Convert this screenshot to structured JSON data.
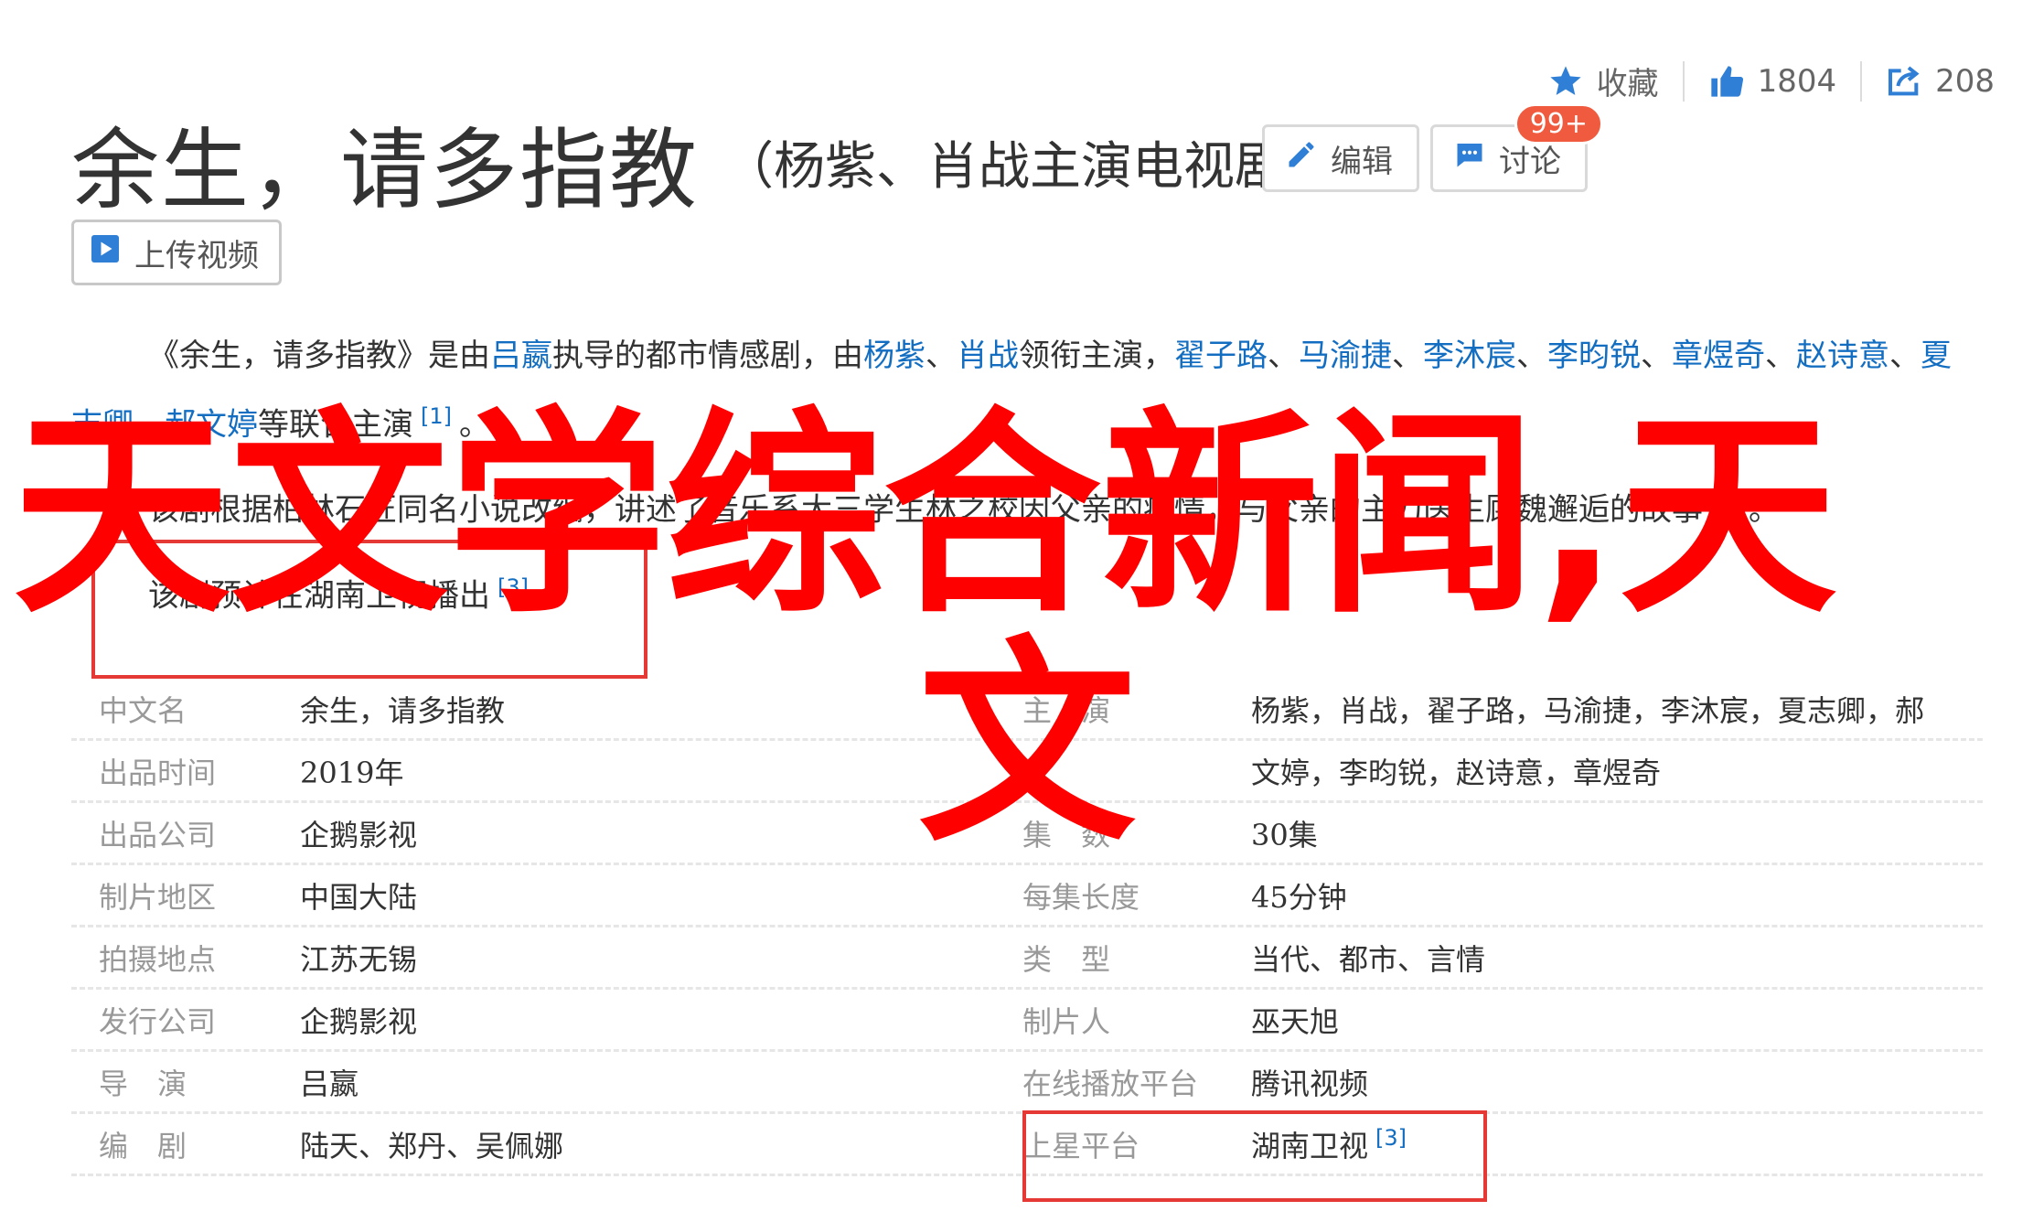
{
  "header": {
    "actions": [
      {
        "icon": "star-icon",
        "label": "收藏"
      },
      {
        "icon": "thumbs-up-icon",
        "label": "1804"
      },
      {
        "icon": "share-icon",
        "label": "208"
      }
    ],
    "title": "余生，请多指教",
    "subtitle": "（杨紫、肖战主演电视剧）",
    "edit_label": "编辑",
    "discuss_label": "讨论",
    "discuss_badge": "99+",
    "upload_label": "上传视频"
  },
  "summary": {
    "p1": {
      "t1": "《余生，请多指教》是由",
      "director": "吕嬴",
      "t2": "执导的都市情感剧，由",
      "lead1": "杨紫",
      "sep1": "、",
      "lead2": "肖战",
      "t3": "领衔主演，",
      "cast": [
        "翟子路",
        "马渝捷",
        "李沐宸",
        "李昀锐",
        "章煜奇",
        "赵诗意",
        "夏志卿",
        "郝文婷"
      ],
      "t4": "等联合主演",
      "ref": "[1]",
      "end": "。"
    },
    "p2": {
      "text": "该剧根据柏林石匠同名小说改编，讲述了音乐系大三学生林之校因父亲的病情，与父亲的主刀医生顾魏邂逅的故事",
      "ref": "[2]",
      "end": "。"
    },
    "p3": {
      "text": "该剧预计在湖南卫视播出",
      "ref": "[3]"
    }
  },
  "info": {
    "left": [
      {
        "k": "中文名",
        "v": "余生，请多指教"
      },
      {
        "k": "出品时间",
        "v": "2019年"
      },
      {
        "k": "出品公司",
        "v": "企鹅影视"
      },
      {
        "k": "制片地区",
        "v": "中国大陆"
      },
      {
        "k": "拍摄地点",
        "v": "江苏无锡"
      },
      {
        "k": "发行公司",
        "v": "企鹅影视"
      },
      {
        "k": "导　演",
        "v": "吕嬴"
      },
      {
        "k": "编　剧",
        "v": "陆天、郑丹、吴佩娜"
      }
    ],
    "right": [
      {
        "k": "主　演",
        "v": "杨紫，肖战，翟子路，马渝捷，李沐宸，夏志卿，郝"
      },
      {
        "k": "",
        "v": "文婷，李昀锐，赵诗意，章煜奇"
      },
      {
        "k": "集　数",
        "v": "30集"
      },
      {
        "k": "每集长度",
        "v": "45分钟"
      },
      {
        "k": "类　型",
        "v": "当代、都市、言情"
      },
      {
        "k": "制片人",
        "v": "巫天旭"
      },
      {
        "k": "在线播放平台",
        "v": "腾讯视频"
      },
      {
        "k": "上星平台",
        "v": "湖南卫视",
        "ref": "[3]"
      }
    ]
  },
  "overlay": {
    "line1": "天文学综合新闻,天",
    "line2": "文"
  },
  "colors": {
    "link": "#136ec2",
    "overlay_red": "#ff0000",
    "box_red": "#e53935",
    "badge": "#f05a3e"
  }
}
